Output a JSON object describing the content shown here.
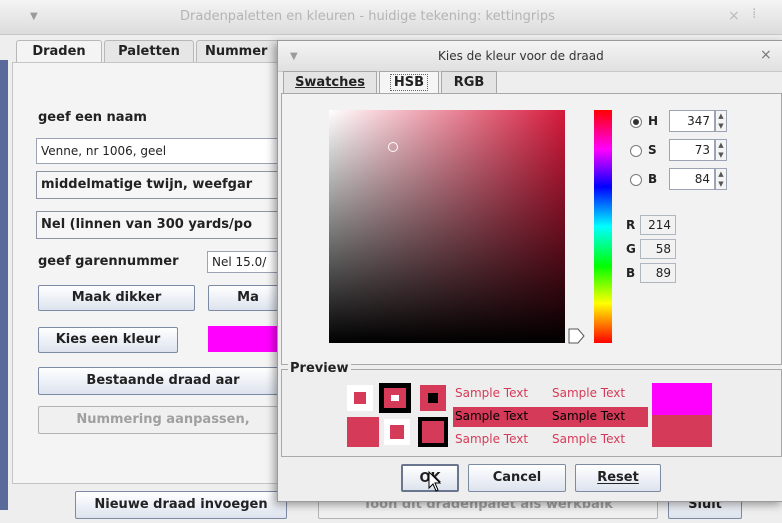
{
  "background_window": {
    "title": "Dradenpaletten en kleuren - huidige tekening: kettingrips",
    "tabs": [
      "Draden",
      "Paletten",
      "Nummer"
    ],
    "name_label": "geef een naam",
    "name_value": "Venne, nr 1006, geel",
    "combo1": "middelmatige twijn, weefgar",
    "combo2": "Nel (linnen van 300 yards/po",
    "garen_label": "geef garennummer",
    "garen_value": "Nel 15.0/",
    "btn_dikker": "Maak dikker",
    "btn_dunner": "Ma",
    "btn_kleur": "Kies een kleur",
    "current_color": "#ff00ff",
    "btn_bestaande": "Bestaande draad aar",
    "btn_nummering": "Nummering aanpassen,",
    "btn_nieuwe": "Nieuwe draad invoegen",
    "btn_toon": "Toon dit dradenpalet als werkbalk",
    "btn_sluit": "Sluit"
  },
  "dialog": {
    "title": "Kies de kleur voor de draad",
    "tabs": [
      "Swatches",
      "HSB",
      "RGB"
    ],
    "active_tab": "HSB",
    "hsb": {
      "h_label": "H",
      "h_value": "347",
      "s_label": "S",
      "s_value": "73",
      "b_label": "B",
      "b_value": "84",
      "selected": "H"
    },
    "rgb": {
      "r_label": "R",
      "r_value": "214",
      "g_label": "G",
      "g_value": "58",
      "b_label": "B",
      "b_value": "89"
    },
    "preview": {
      "label": "Preview",
      "sample_text": "Sample Text",
      "new_color": "#d63a59",
      "old_color": "#ff00ff"
    },
    "buttons": {
      "ok": "OK",
      "cancel": "Cancel",
      "reset": "Reset"
    }
  }
}
